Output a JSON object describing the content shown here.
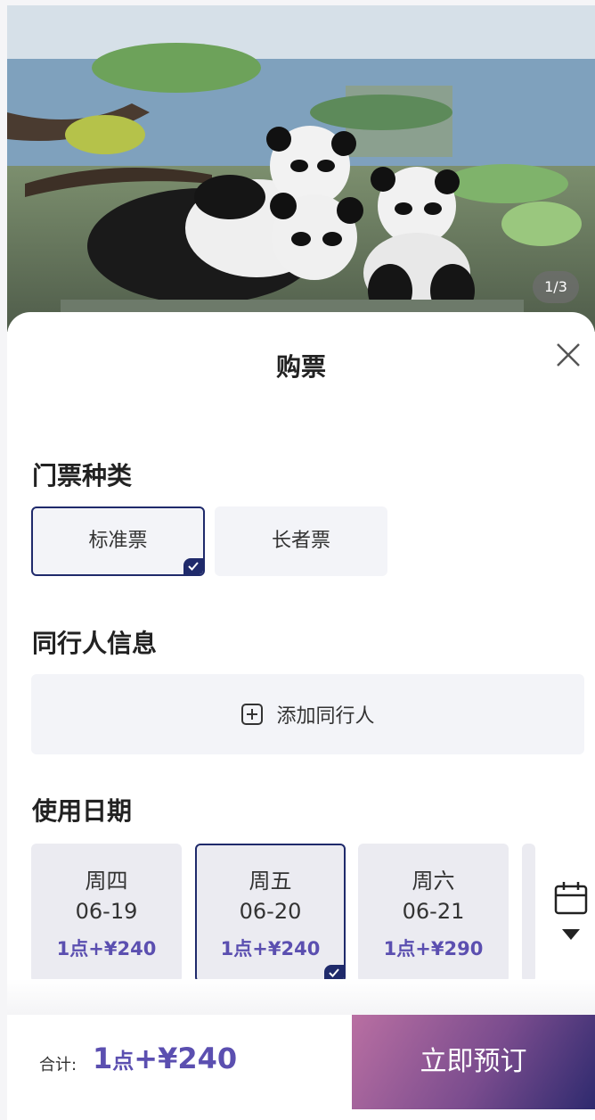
{
  "hero": {
    "counter": "1/3"
  },
  "sheet": {
    "title": "购票"
  },
  "ticket_type": {
    "title": "门票种类",
    "options": [
      {
        "label": "标准票",
        "selected": true
      },
      {
        "label": "长者票",
        "selected": false
      }
    ]
  },
  "companions": {
    "title": "同行人信息",
    "add_label": "添加同行人"
  },
  "date": {
    "title": "使用日期",
    "days": [
      {
        "weekday": "周四",
        "date": "06-19",
        "price": "1点+¥240",
        "selected": false
      },
      {
        "weekday": "周五",
        "date": "06-20",
        "price": "1点+¥240",
        "selected": true
      },
      {
        "weekday": "周六",
        "date": "06-21",
        "price": "1点+¥290",
        "selected": false
      }
    ]
  },
  "footer": {
    "total_label": "合计:",
    "total_points": "1",
    "total_points_unit": "点",
    "total_price": "+¥240",
    "book_label": "立即预订"
  },
  "colors": {
    "accent": "#5b4fb0",
    "selected_border": "#1f2a6b"
  },
  "icons": [
    "close-icon",
    "plus-square-icon",
    "calendar-icon",
    "caret-down-icon",
    "checkmark-icon"
  ]
}
